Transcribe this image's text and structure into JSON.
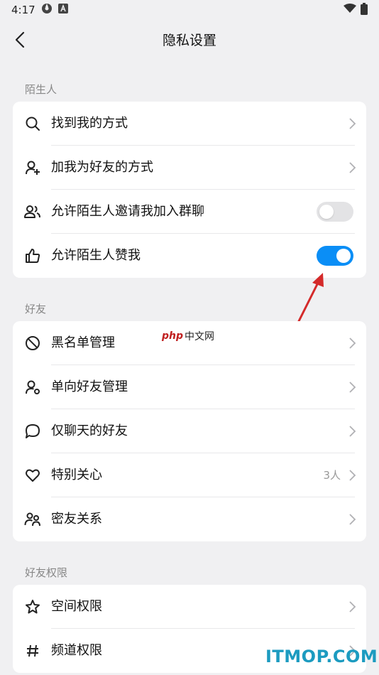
{
  "status_bar": {
    "time": "4:17"
  },
  "header": {
    "title": "隐私设置"
  },
  "sections": {
    "strangers": {
      "label": "陌生人",
      "items": [
        {
          "label": "找到我的方式"
        },
        {
          "label": "加我为好友的方式"
        },
        {
          "label": "允许陌生人邀请我加入群聊",
          "toggle": false
        },
        {
          "label": "允许陌生人赞我",
          "toggle": true
        }
      ]
    },
    "friends": {
      "label": "好友",
      "items": [
        {
          "label": "黑名单管理"
        },
        {
          "label": "单向好友管理"
        },
        {
          "label": "仅聊天的好友"
        },
        {
          "label": "特别关心",
          "count": "3人"
        },
        {
          "label": "密友关系"
        }
      ]
    },
    "friend_permissions": {
      "label": "好友权限",
      "items": [
        {
          "label": "空间权限"
        },
        {
          "label": "频道权限"
        }
      ]
    }
  },
  "watermarks": {
    "php_logo": "php",
    "php_text": "中文网",
    "itmop": "ITMOP.COM"
  },
  "colors": {
    "accent": "#0a8ef6",
    "background": "#f0f0f2",
    "annotation_arrow": "#d42a2a"
  }
}
